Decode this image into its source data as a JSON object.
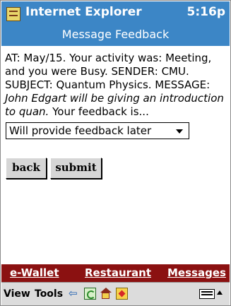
{
  "titlebar": {
    "app_title": "Internet Explorer",
    "time": "5:16p",
    "page_title": "Message Feedback"
  },
  "message": {
    "part1": "AT: May/15. Your activity was: Meeting, and you were Busy. SENDER: CMU. SUBJECT: Quantum Physics. MESSAGE: ",
    "italic": "John Edgart will be giving an introduction to quan.",
    "part2": " Your feedback is..."
  },
  "feedback_select": {
    "selected": "Will provide feedback later"
  },
  "buttons": {
    "back": "back",
    "submit": "submit"
  },
  "nav": {
    "items": [
      "e-Wallet",
      "Restaurant",
      "Messages"
    ]
  },
  "command_bar": {
    "view": "View",
    "tools": "Tools",
    "back_icon": "back-arrow",
    "refresh_icon": "refresh",
    "home_icon": "home",
    "favorites_icon": "favorites",
    "keyboard_icon": "keyboard"
  },
  "colors": {
    "titlebar": "#3c86c6",
    "navbar": "#8b1111",
    "cmdbar": "#dcdcdc"
  }
}
